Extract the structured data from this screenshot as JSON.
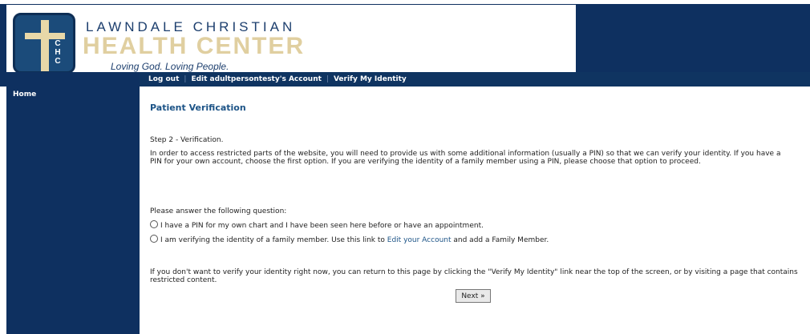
{
  "header": {
    "org_line1": "LAWNDALE CHRISTIAN",
    "org_line2": "HEALTH CENTER",
    "tagline": "Loving God. Loving People.",
    "logo_letters": [
      "C",
      "H",
      "C"
    ]
  },
  "nav": {
    "logout": "Log out",
    "edit_account": "Edit adultpersontesty's Account",
    "verify": "Verify My Identity",
    "separator": "|"
  },
  "sidebar": {
    "home": "Home"
  },
  "main": {
    "title": "Patient Verification",
    "step": "Step 2 - Verification.",
    "intro": "In order to access restricted parts of the website, you will need to provide us with some additional information (usually a PIN) so that we can verify your identity. If you have a PIN for your own account, choose the first option. If you are verifying the identity of a family member using a PIN, please choose that option to proceed.",
    "question": "Please answer the following question:",
    "option1": "I have a PIN for my own chart and I have been seen here before or have an appointment.",
    "option2_prefix": "I am verifying the identity of a family member. Use this link to",
    "option2_link": "Edit your Account",
    "option2_suffix": "and add a Family Member.",
    "footer": "If you don't want to verify your identity right now, you can return to this page by clicking the \"Verify My Identity\" link near the top of the screen, or by visiting a page that contains restricted content.",
    "next_button": "Next »"
  },
  "colors": {
    "navy": "#0e3060",
    "title_blue": "#1d5487",
    "gold": "#e0cfa0"
  }
}
